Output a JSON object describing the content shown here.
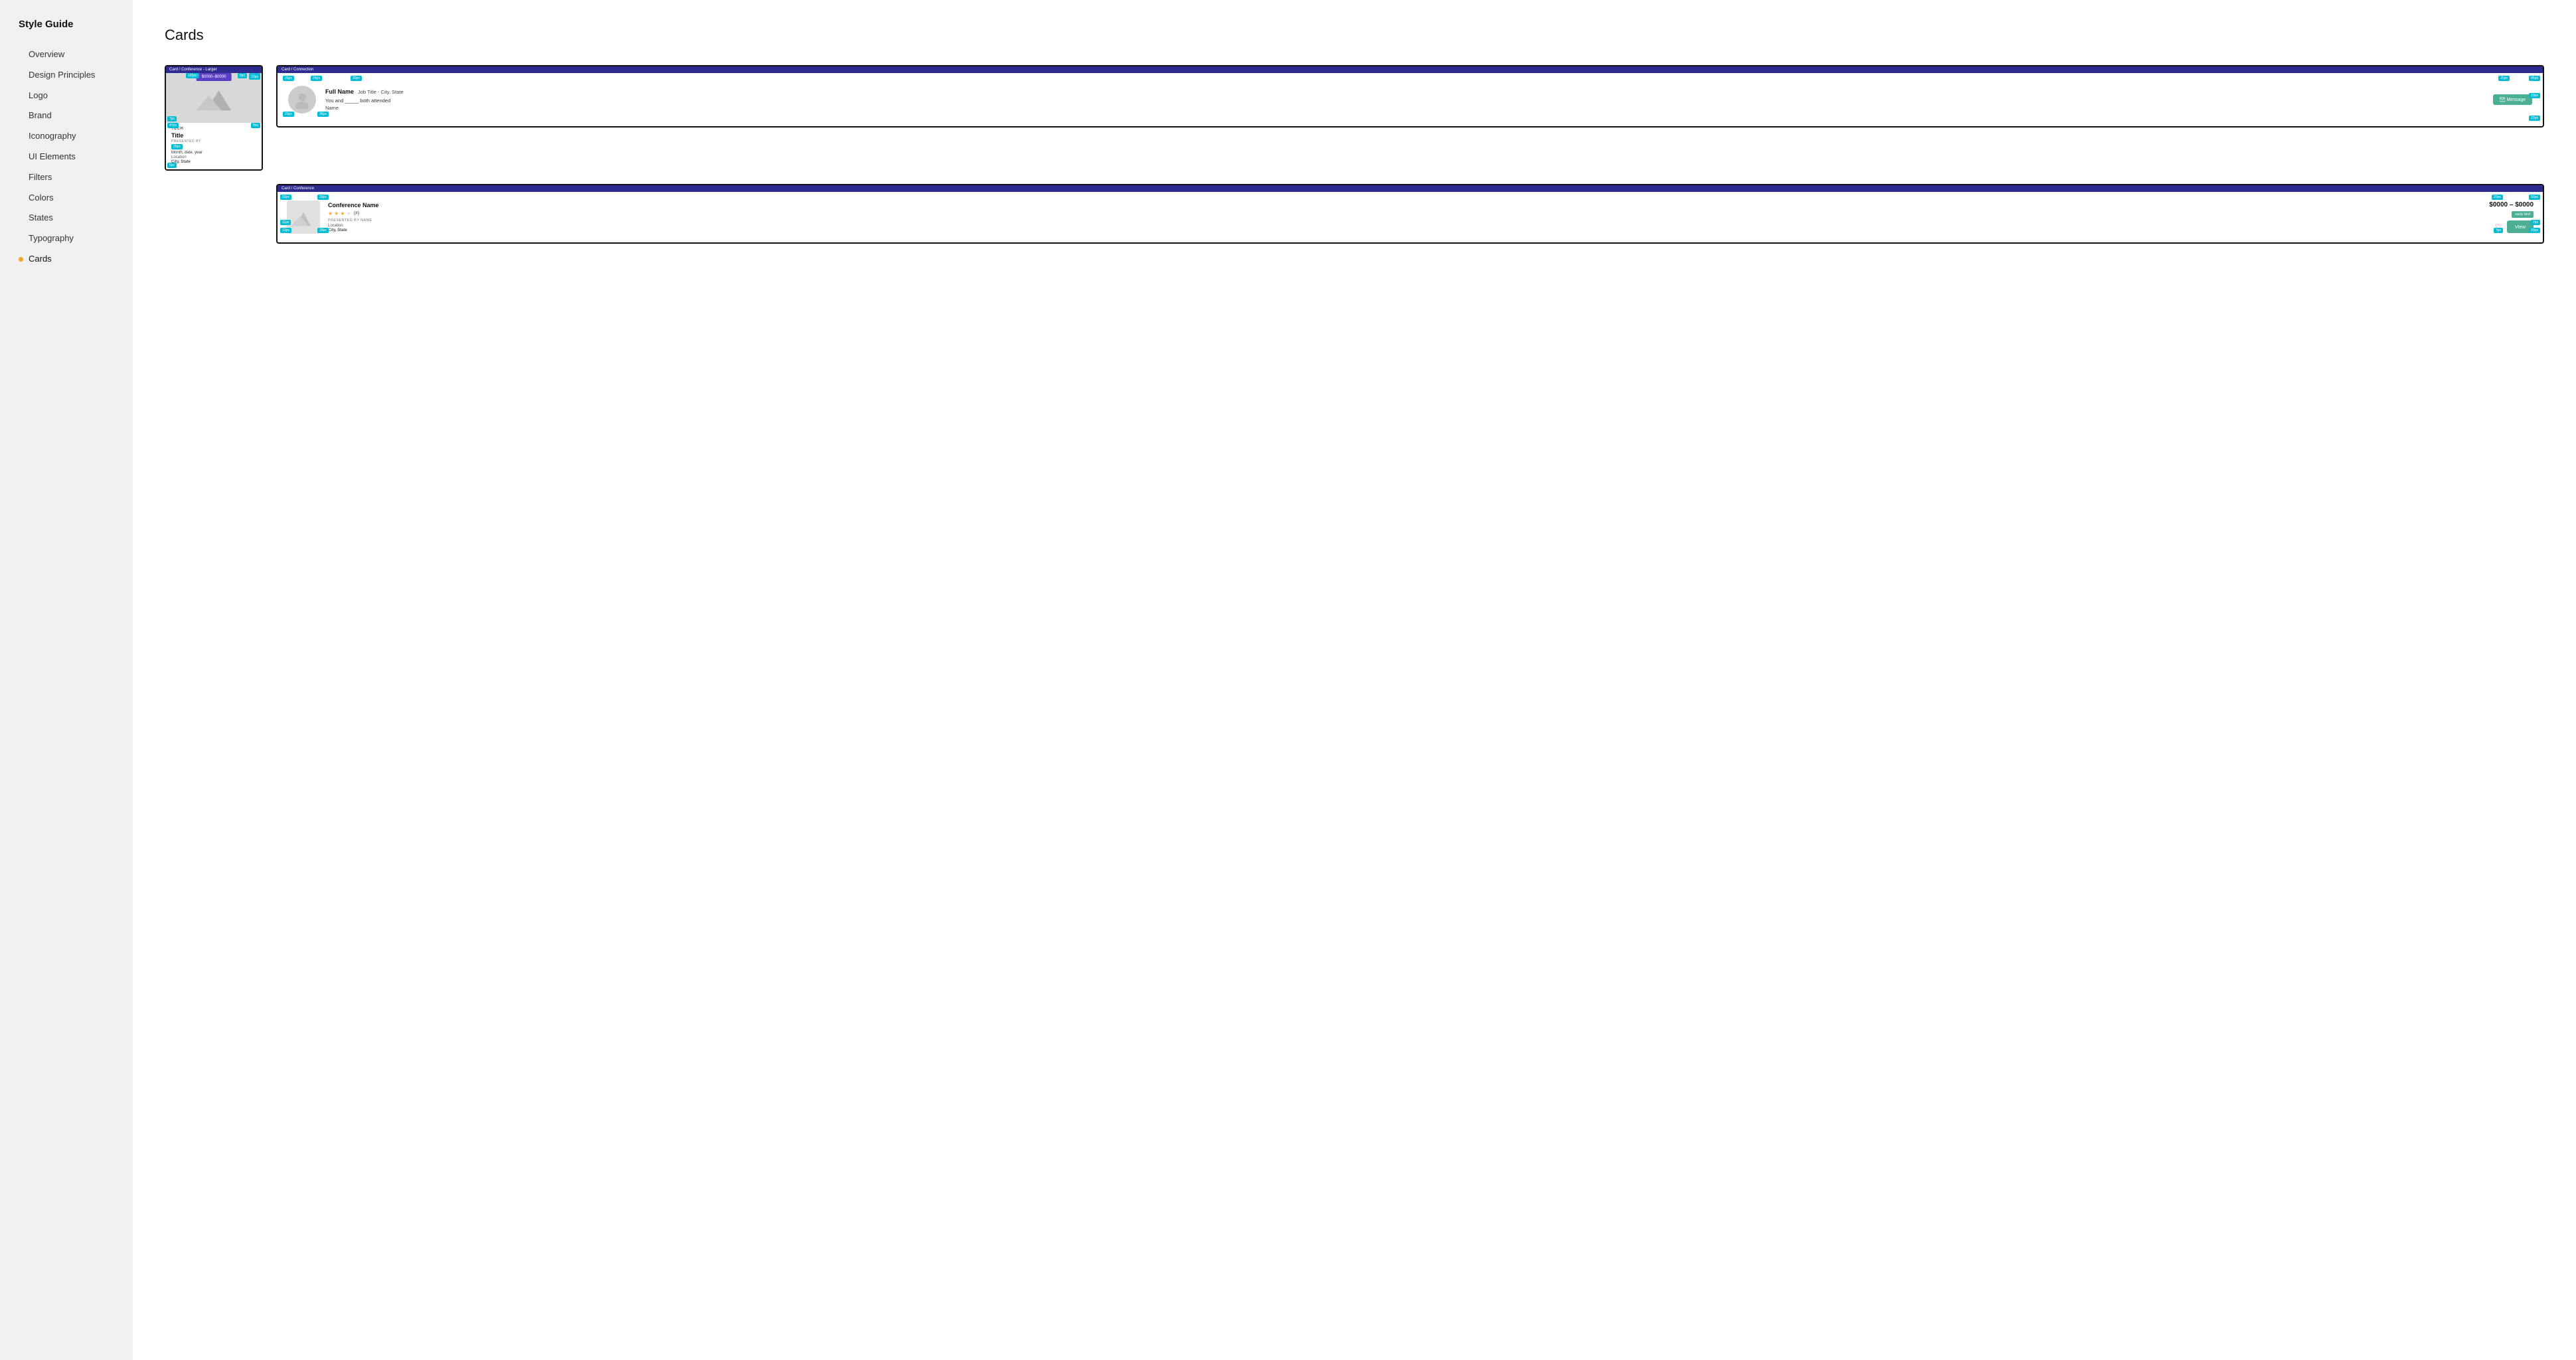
{
  "app": {
    "title": "Style Guide"
  },
  "sidebar": {
    "items": [
      {
        "id": "overview",
        "label": "Overview",
        "active": false,
        "dot": false
      },
      {
        "id": "design-principles",
        "label": "Design Principles",
        "active": false,
        "dot": false
      },
      {
        "id": "logo",
        "label": "Logo",
        "active": false,
        "dot": false
      },
      {
        "id": "brand",
        "label": "Brand",
        "active": false,
        "dot": false
      },
      {
        "id": "iconography",
        "label": "Iconography",
        "active": false,
        "dot": false
      },
      {
        "id": "ui-elements",
        "label": "UI Elements",
        "active": false,
        "dot": false
      },
      {
        "id": "filters",
        "label": "Filters",
        "active": false,
        "dot": false
      },
      {
        "id": "colors",
        "label": "Colors",
        "active": false,
        "dot": false
      },
      {
        "id": "states",
        "label": "States",
        "active": false,
        "dot": false
      },
      {
        "id": "typography",
        "label": "Typography",
        "active": false,
        "dot": false
      },
      {
        "id": "cards",
        "label": "Cards",
        "active": true,
        "dot": true
      }
    ]
  },
  "main": {
    "page_title": "Cards",
    "cards": {
      "conference_larger": {
        "label": "Card / Conference - Larger",
        "price_badge": "$0000–$0000",
        "tag": "TECH",
        "title": "Title",
        "presented_by_label": "PRESENTED BY",
        "presented_by": "26px",
        "date": "Month, date, year",
        "location_label": "Location",
        "city": "City, State"
      },
      "connection": {
        "label": "Card / Connection",
        "full_name": "Full Name",
        "job_title": "Job Title - City, State",
        "attended_text": "You and _____ both attended",
        "name_label": "Name",
        "message_button": "Message"
      },
      "conference_list": {
        "label": "Card / Conference",
        "name": "Conference Name",
        "stars": 3,
        "star_count": "(#)",
        "presented_by_label": "PRESENTED BY NAME",
        "location": "Location",
        "city": "City, State",
        "price": "$0000 – $0000",
        "early_bird": "early bird",
        "view_button": "View"
      }
    }
  }
}
